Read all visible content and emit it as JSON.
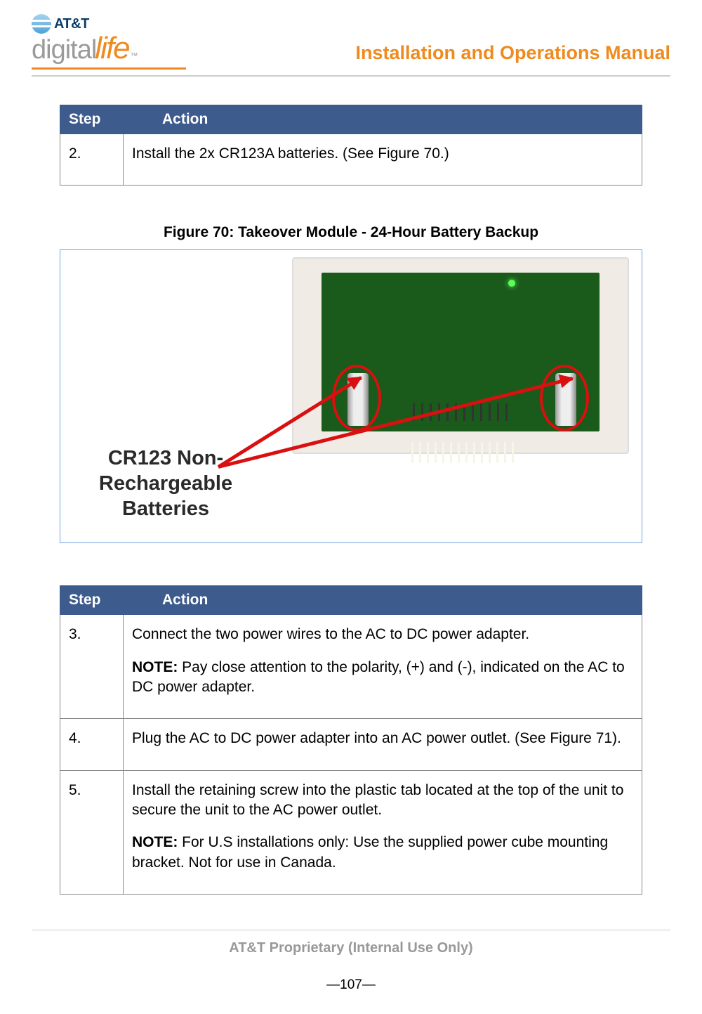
{
  "header": {
    "brand_att": "AT&T",
    "brand_digital": "digital",
    "brand_life": "life",
    "brand_tm": "™",
    "title": "Installation and Operations Manual"
  },
  "table1": {
    "step_header": "Step",
    "action_header": "Action",
    "rows": [
      {
        "step": "2.",
        "action": "Install the 2x CR123A batteries. (See Figure 70.)"
      }
    ]
  },
  "figure": {
    "caption": "Figure 70:  Takeover Module - 24-Hour Battery Backup",
    "label_line1": "CR123 Non-",
    "label_line2": "Rechargeable",
    "label_line3": "Batteries"
  },
  "table2": {
    "step_header": "Step",
    "action_header": "Action",
    "rows": [
      {
        "step": "3.",
        "p1": "Connect the two power wires to the AC to DC power adapter.",
        "note_label": "NOTE:",
        "note_text": "  Pay close attention to the polarity, (+) and (-), indicated on the AC to DC power adapter."
      },
      {
        "step": "4.",
        "p1": "Plug the AC to DC power adapter into an AC power outlet. (See Figure 71)."
      },
      {
        "step": "5.",
        "p1": "Install the retaining screw into the plastic tab located at the top of the unit to secure the unit to the AC power outlet.",
        "note_label": "NOTE:",
        "note_text": " For U.S installations only: Use the supplied power cube mounting bracket. Not for use in Canada."
      }
    ]
  },
  "footer": {
    "proprietary": "AT&T Proprietary (Internal Use Only)",
    "page": "―107―"
  }
}
